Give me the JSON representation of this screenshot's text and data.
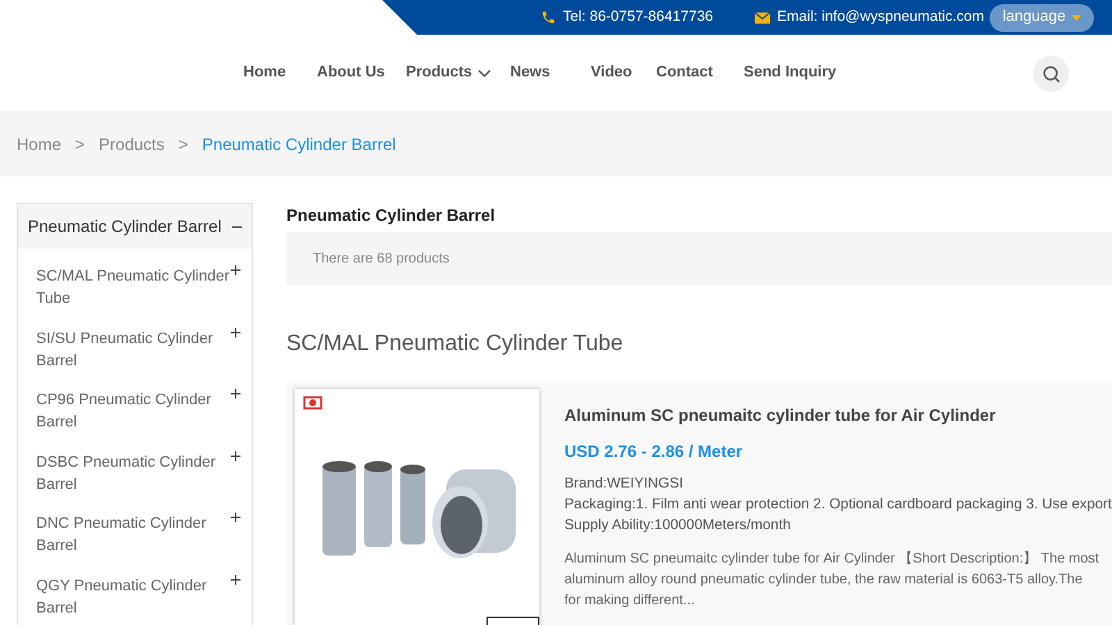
{
  "top_bar": {
    "phone": "Tel: 86-0757-86417736",
    "email": "Email: info@wyspneumatic.com",
    "language_button": "language"
  },
  "nav": {
    "items": [
      {
        "label": "Home",
        "dropdown": false
      },
      {
        "label": "About Us",
        "dropdown": false
      },
      {
        "label": "Products",
        "dropdown": true
      },
      {
        "label": "News",
        "dropdown": false
      },
      {
        "label": "Video",
        "dropdown": false
      },
      {
        "label": "Contact",
        "dropdown": false
      },
      {
        "label": "Send Inquiry",
        "dropdown": false
      }
    ]
  },
  "breadcrumb": {
    "items": [
      {
        "label": "Home",
        "selected": false
      },
      {
        "label": "Products",
        "selected": false
      },
      {
        "label": "Pneumatic Cylinder Barrel",
        "selected": true
      }
    ],
    "separators": [
      ">",
      ">"
    ]
  },
  "sidebar": {
    "header": {
      "label": "Pneumatic Cylinder Barrel",
      "expanded": true
    },
    "items": [
      {
        "label": "SC/MAL Pneumatic Cylinder Tube",
        "expanded": false
      },
      {
        "label": "SI/SU Pneumatic Cylinder Barrel",
        "expanded": false
      },
      {
        "label": "CP96 Pneumatic Cylinder Barrel",
        "expanded": false
      },
      {
        "label": "DSBC Pneumatic Cylinder Barrel",
        "expanded": false
      },
      {
        "label": "DNC Pneumatic Cylinder Barrel",
        "expanded": false
      },
      {
        "label": "QGY Pneumatic Cylinder Barrel",
        "expanded": false
      }
    ]
  },
  "content": {
    "title": "Pneumatic Cylinder Barrel",
    "count": "There are 68 products",
    "section_title": "SC/MAL Pneumatic Cylinder Tube",
    "product": {
      "name": "Aluminum SC pneumaitc cylinder tube for Air Cylinder",
      "price": "USD 2.76 - 2.86 / Meter",
      "specs": [
        "Brand:WEIYINGSI",
        "Packaging:1. Film anti wear protection 2. Optional cardboard packaging 3. Use export",
        "Supply Ability:100000Meters/month"
      ],
      "description_lines": [
        "Aluminum SC pneumaitc cylinder tube for Air Cylinder 【Short Description:】 The most",
        "aluminum alloy round pneumatic cylinder tube, the raw material is 6063-T5 alloy.The",
        "for making different..."
      ]
    }
  }
}
